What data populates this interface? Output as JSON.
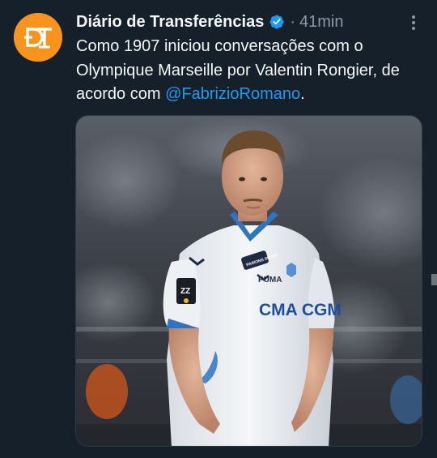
{
  "tweet": {
    "author": {
      "display_name": "Diário de Transferências",
      "verified": true,
      "avatar_icon": "dt-logo-icon",
      "avatar_color": "#f7941d"
    },
    "time": "41min",
    "separator": "·",
    "text_part1": "Como 1907 iniciou conversações com o Olympique Marseille por Valentin Rongier, de acordo com ",
    "mention": "@FabrizioRomano",
    "text_end": ".",
    "media": {
      "kind": "photo",
      "jersey_sponsor": "CMA CGM",
      "jersey_brand": "PUMA",
      "sleeve_patch": "PARIONS SPORT",
      "badge_text": "ZZ"
    }
  },
  "colors": {
    "background": "#15202b",
    "text": "#f7f9f9",
    "secondary": "#8b98a5",
    "link": "#1d9bf0",
    "verified": "#1d9bf0"
  }
}
